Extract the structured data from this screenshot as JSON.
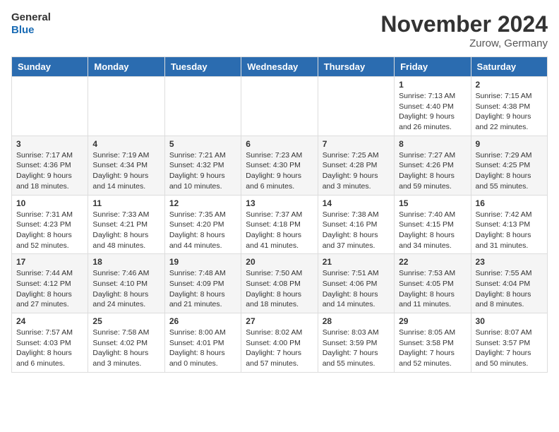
{
  "header": {
    "logo_line1": "General",
    "logo_line2": "Blue",
    "month_title": "November 2024",
    "location": "Zurow, Germany"
  },
  "weekdays": [
    "Sunday",
    "Monday",
    "Tuesday",
    "Wednesday",
    "Thursday",
    "Friday",
    "Saturday"
  ],
  "weeks": [
    [
      {
        "day": "",
        "info": ""
      },
      {
        "day": "",
        "info": ""
      },
      {
        "day": "",
        "info": ""
      },
      {
        "day": "",
        "info": ""
      },
      {
        "day": "",
        "info": ""
      },
      {
        "day": "1",
        "info": "Sunrise: 7:13 AM\nSunset: 4:40 PM\nDaylight: 9 hours and 26 minutes."
      },
      {
        "day": "2",
        "info": "Sunrise: 7:15 AM\nSunset: 4:38 PM\nDaylight: 9 hours and 22 minutes."
      }
    ],
    [
      {
        "day": "3",
        "info": "Sunrise: 7:17 AM\nSunset: 4:36 PM\nDaylight: 9 hours and 18 minutes."
      },
      {
        "day": "4",
        "info": "Sunrise: 7:19 AM\nSunset: 4:34 PM\nDaylight: 9 hours and 14 minutes."
      },
      {
        "day": "5",
        "info": "Sunrise: 7:21 AM\nSunset: 4:32 PM\nDaylight: 9 hours and 10 minutes."
      },
      {
        "day": "6",
        "info": "Sunrise: 7:23 AM\nSunset: 4:30 PM\nDaylight: 9 hours and 6 minutes."
      },
      {
        "day": "7",
        "info": "Sunrise: 7:25 AM\nSunset: 4:28 PM\nDaylight: 9 hours and 3 minutes."
      },
      {
        "day": "8",
        "info": "Sunrise: 7:27 AM\nSunset: 4:26 PM\nDaylight: 8 hours and 59 minutes."
      },
      {
        "day": "9",
        "info": "Sunrise: 7:29 AM\nSunset: 4:25 PM\nDaylight: 8 hours and 55 minutes."
      }
    ],
    [
      {
        "day": "10",
        "info": "Sunrise: 7:31 AM\nSunset: 4:23 PM\nDaylight: 8 hours and 52 minutes."
      },
      {
        "day": "11",
        "info": "Sunrise: 7:33 AM\nSunset: 4:21 PM\nDaylight: 8 hours and 48 minutes."
      },
      {
        "day": "12",
        "info": "Sunrise: 7:35 AM\nSunset: 4:20 PM\nDaylight: 8 hours and 44 minutes."
      },
      {
        "day": "13",
        "info": "Sunrise: 7:37 AM\nSunset: 4:18 PM\nDaylight: 8 hours and 41 minutes."
      },
      {
        "day": "14",
        "info": "Sunrise: 7:38 AM\nSunset: 4:16 PM\nDaylight: 8 hours and 37 minutes."
      },
      {
        "day": "15",
        "info": "Sunrise: 7:40 AM\nSunset: 4:15 PM\nDaylight: 8 hours and 34 minutes."
      },
      {
        "day": "16",
        "info": "Sunrise: 7:42 AM\nSunset: 4:13 PM\nDaylight: 8 hours and 31 minutes."
      }
    ],
    [
      {
        "day": "17",
        "info": "Sunrise: 7:44 AM\nSunset: 4:12 PM\nDaylight: 8 hours and 27 minutes."
      },
      {
        "day": "18",
        "info": "Sunrise: 7:46 AM\nSunset: 4:10 PM\nDaylight: 8 hours and 24 minutes."
      },
      {
        "day": "19",
        "info": "Sunrise: 7:48 AM\nSunset: 4:09 PM\nDaylight: 8 hours and 21 minutes."
      },
      {
        "day": "20",
        "info": "Sunrise: 7:50 AM\nSunset: 4:08 PM\nDaylight: 8 hours and 18 minutes."
      },
      {
        "day": "21",
        "info": "Sunrise: 7:51 AM\nSunset: 4:06 PM\nDaylight: 8 hours and 14 minutes."
      },
      {
        "day": "22",
        "info": "Sunrise: 7:53 AM\nSunset: 4:05 PM\nDaylight: 8 hours and 11 minutes."
      },
      {
        "day": "23",
        "info": "Sunrise: 7:55 AM\nSunset: 4:04 PM\nDaylight: 8 hours and 8 minutes."
      }
    ],
    [
      {
        "day": "24",
        "info": "Sunrise: 7:57 AM\nSunset: 4:03 PM\nDaylight: 8 hours and 6 minutes."
      },
      {
        "day": "25",
        "info": "Sunrise: 7:58 AM\nSunset: 4:02 PM\nDaylight: 8 hours and 3 minutes."
      },
      {
        "day": "26",
        "info": "Sunrise: 8:00 AM\nSunset: 4:01 PM\nDaylight: 8 hours and 0 minutes."
      },
      {
        "day": "27",
        "info": "Sunrise: 8:02 AM\nSunset: 4:00 PM\nDaylight: 7 hours and 57 minutes."
      },
      {
        "day": "28",
        "info": "Sunrise: 8:03 AM\nSunset: 3:59 PM\nDaylight: 7 hours and 55 minutes."
      },
      {
        "day": "29",
        "info": "Sunrise: 8:05 AM\nSunset: 3:58 PM\nDaylight: 7 hours and 52 minutes."
      },
      {
        "day": "30",
        "info": "Sunrise: 8:07 AM\nSunset: 3:57 PM\nDaylight: 7 hours and 50 minutes."
      }
    ]
  ]
}
